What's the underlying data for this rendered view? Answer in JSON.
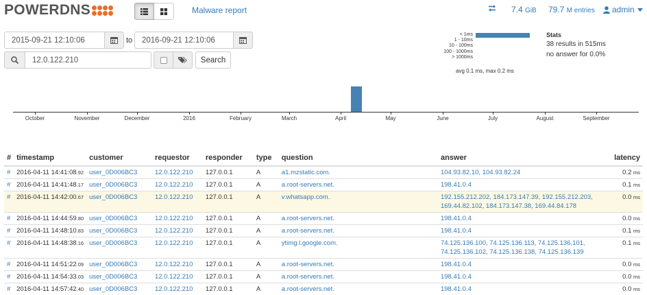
{
  "nav": {
    "logo_text": "POWERDNS",
    "malware_link": "Malware report",
    "storage": {
      "value": "7.4",
      "unit": "GiB"
    },
    "entries": {
      "value": "79.7",
      "unit": "M entries"
    },
    "user": "admin"
  },
  "search": {
    "from": "2015-09-21 12:10:06",
    "to_label": "to",
    "to": "2016-09-21 12:10:06",
    "query": "12.0.122.210",
    "button": "Search"
  },
  "latency": {
    "buckets": [
      {
        "label": "< 1ms",
        "fraction": 1.0
      },
      {
        "label": "1 - 10ms",
        "fraction": 0
      },
      {
        "label": "10 - 100ms",
        "fraction": 0
      },
      {
        "label": "100 - 1000ms",
        "fraction": 0
      },
      {
        "label": "> 1000ms",
        "fraction": 0
      }
    ],
    "summary": "avg 0.1 ms, max 0.2 ms"
  },
  "stats": {
    "title": "Stats",
    "results": "38 results in 515ms",
    "no_answer": "no answer for 0.0%"
  },
  "timeline": {
    "months": [
      "October",
      "November",
      "December",
      "2016",
      "February",
      "March",
      "April",
      "May",
      "June",
      "July",
      "August",
      "September"
    ],
    "spike": {
      "month_index": 6,
      "fraction": 1.0
    }
  },
  "table": {
    "headers": [
      "#",
      "timestamp",
      "customer",
      "requestor",
      "responder",
      "type",
      "question",
      "answer",
      "latency"
    ],
    "rows": [
      {
        "hash": "#",
        "ts": "2016-04-11 14:41:08",
        "ts_frac": ".92",
        "customer": "user_0D006BC3",
        "requestor": "12.0.122.210",
        "responder": "127.0.0.1",
        "type": "A",
        "question": "a1.mzstatic.com.",
        "answer": "104.93.82.10, 104.93.82.24",
        "latency": "0.2",
        "unit": "ms",
        "highlight": false
      },
      {
        "hash": "#",
        "ts": "2016-04-11 14:41:48",
        "ts_frac": ".17",
        "customer": "user_0D006BC3",
        "requestor": "12.0.122.210",
        "responder": "127.0.0.1",
        "type": "A",
        "question": "a.root-servers.net.",
        "answer": "198.41.0.4",
        "latency": "0.1",
        "unit": "ms",
        "highlight": false
      },
      {
        "hash": "#",
        "ts": "2016-04-11 14:42:00",
        "ts_frac": ".67",
        "customer": "user_0D006BC3",
        "requestor": "12.0.122.210",
        "responder": "127.0.0.1",
        "type": "A",
        "question": "v.whatsapp.com.",
        "answer": "192.155.212.202, 184.173.147.39, 192.155.212.203, 169.44.82.102, 184.173.147.38, 169.44.84.178",
        "latency": "0.0",
        "unit": "ms",
        "highlight": true
      },
      {
        "hash": "#",
        "ts": "2016-04-11 14:44:59",
        "ts_frac": ".80",
        "customer": "user_0D006BC3",
        "requestor": "12.0.122.210",
        "responder": "127.0.0.1",
        "type": "A",
        "question": "a.root-servers.net.",
        "answer": "198.41.0.4",
        "latency": "0.0",
        "unit": "ms",
        "highlight": false
      },
      {
        "hash": "#",
        "ts": "2016-04-11 14:48:10",
        "ts_frac": ".83",
        "customer": "user_0D006BC3",
        "requestor": "12.0.122.210",
        "responder": "127.0.0.1",
        "type": "A",
        "question": "a.root-servers.net.",
        "answer": "198.41.0.4",
        "latency": "0.1",
        "unit": "ms",
        "highlight": false
      },
      {
        "hash": "#",
        "ts": "2016-04-11 14:48:38",
        "ts_frac": ".16",
        "customer": "user_0D006BC3",
        "requestor": "12.0.122.210",
        "responder": "127.0.0.1",
        "type": "A",
        "question": "ytimg.l.google.com.",
        "answer": "74.125.136.100, 74.125.136.113, 74.125.136.101, 74.125.136.102, 74.125.136.138, 74.125.136.139",
        "latency": "0.1",
        "unit": "ms",
        "highlight": false
      },
      {
        "hash": "#",
        "ts": "2016-04-11 14:51:22",
        "ts_frac": ".09",
        "customer": "user_0D006BC3",
        "requestor": "12.0.122.210",
        "responder": "127.0.0.1",
        "type": "A",
        "question": "a.root-servers.net.",
        "answer": "198.41.0.4",
        "latency": "0.0",
        "unit": "ms",
        "highlight": false
      },
      {
        "hash": "#",
        "ts": "2016-04-11 14:54:33",
        "ts_frac": ".03",
        "customer": "user_0D006BC3",
        "requestor": "12.0.122.210",
        "responder": "127.0.0.1",
        "type": "A",
        "question": "a.root-servers.net.",
        "answer": "198.41.0.4",
        "latency": "0.0",
        "unit": "ms",
        "highlight": false
      },
      {
        "hash": "#",
        "ts": "2016-04-11 14:57:42",
        "ts_frac": ".40",
        "customer": "user_0D006BC3",
        "requestor": "12.0.122.210",
        "responder": "127.0.0.1",
        "type": "A",
        "question": "a.root-servers.net.",
        "answer": "198.41.0.4",
        "latency": "0.0",
        "unit": "ms",
        "highlight": false
      }
    ]
  }
}
